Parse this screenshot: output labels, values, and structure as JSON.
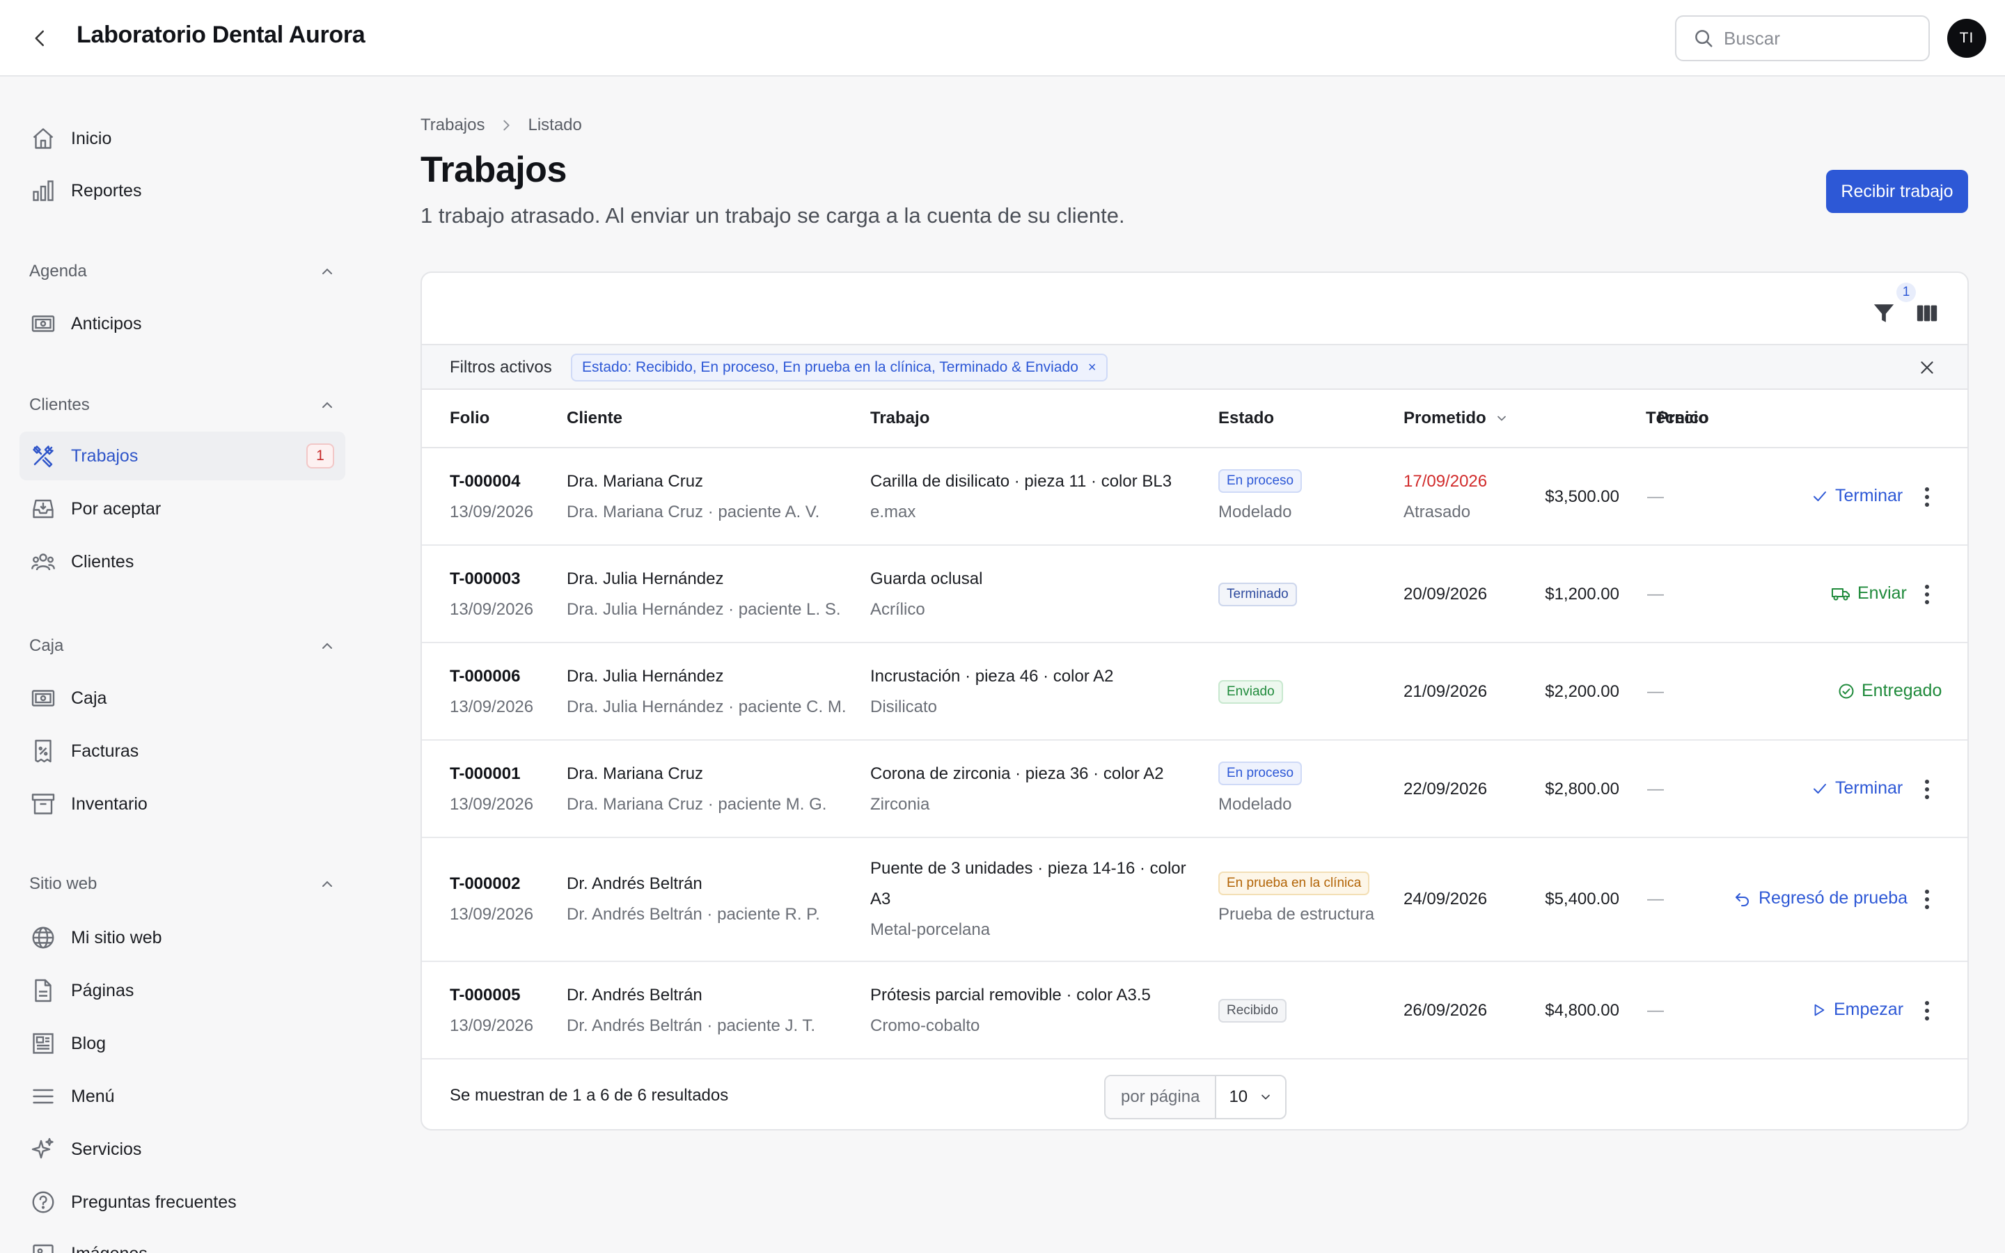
{
  "header": {
    "title": "Laboratorio Dental Aurora",
    "search_placeholder": "Buscar",
    "avatar_initials": "TI"
  },
  "sidebar": {
    "items_top": [
      {
        "label": "Inicio",
        "icon": "home-icon"
      },
      {
        "label": "Reportes",
        "icon": "bar-chart-icon"
      }
    ],
    "sections": [
      {
        "title": "Agenda",
        "items": [
          {
            "label": "Anticipos",
            "icon": "cash-icon"
          }
        ]
      },
      {
        "title": "Clientes",
        "items": [
          {
            "label": "Trabajos",
            "icon": "tools-icon",
            "active": true,
            "badge": "1"
          },
          {
            "label": "Por aceptar",
            "icon": "inbox-icon"
          },
          {
            "label": "Clientes",
            "icon": "users-icon"
          }
        ]
      },
      {
        "title": "Caja",
        "items": [
          {
            "label": "Caja",
            "icon": "cash-icon"
          },
          {
            "label": "Facturas",
            "icon": "receipt-icon"
          },
          {
            "label": "Inventario",
            "icon": "archive-icon"
          }
        ]
      },
      {
        "title": "Sitio web",
        "items": [
          {
            "label": "Mi sitio web",
            "icon": "globe-icon"
          },
          {
            "label": "Páginas",
            "icon": "file-icon"
          },
          {
            "label": "Blog",
            "icon": "newspaper-icon"
          },
          {
            "label": "Menú",
            "icon": "menu-icon"
          },
          {
            "label": "Servicios",
            "icon": "sparkles-icon"
          },
          {
            "label": "Preguntas frecuentes",
            "icon": "question-icon"
          },
          {
            "label": "Imágenes",
            "icon": "image-icon"
          }
        ]
      }
    ]
  },
  "breadcrumb": {
    "root": "Trabajos",
    "current": "Listado"
  },
  "page": {
    "title": "Trabajos",
    "subtitle": "1 trabajo atrasado. Al enviar un trabajo se carga a la cuenta de su cliente.",
    "primary_action": "Recibir trabajo"
  },
  "toolbar": {
    "filter_count": "1"
  },
  "filters": {
    "label": "Filtros activos",
    "chip": "Estado: Recibido, En proceso, En prueba en la clínica, Terminado & Enviado",
    "chip_remove": "×"
  },
  "table": {
    "columns": {
      "folio": "Folio",
      "cliente": "Cliente",
      "trabajo": "Trabajo",
      "estado": "Estado",
      "prometido": "Prometido",
      "precio": "Precio",
      "tecnico": "Técnico"
    },
    "rows": [
      {
        "folio": "T-000004",
        "fecha": "13/09/2026",
        "cliente": "Dra. Mariana Cruz",
        "cliente_sub": "Dra. Mariana Cruz · paciente A. V.",
        "trabajo": "Carilla de disilicato · pieza 11 · color BL3",
        "trabajo_sub": "e.max",
        "estado": "En proceso",
        "estado_tipo": "proceso",
        "estado_sub": "Modelado",
        "prometido": "17/09/2026",
        "prometido_sub": "Atrasado",
        "precio": "$3,500.00",
        "tecnico": "—",
        "accion": "Terminar",
        "accion_icon": "check-icon",
        "accion_color": "blue",
        "menu": true
      },
      {
        "folio": "T-000003",
        "fecha": "13/09/2026",
        "cliente": "Dra. Julia Hernández",
        "cliente_sub": "Dra. Julia Hernández · paciente L. S.",
        "trabajo": "Guarda oclusal",
        "trabajo_sub": "Acrílico",
        "estado": "Terminado",
        "estado_tipo": "terminado",
        "estado_sub": "",
        "prometido": "20/09/2026",
        "prometido_sub": "",
        "precio": "$1,200.00",
        "tecnico": "—",
        "accion": "Enviar",
        "accion_icon": "truck-icon",
        "accion_color": "green",
        "menu": true
      },
      {
        "folio": "T-000006",
        "fecha": "13/09/2026",
        "cliente": "Dra. Julia Hernández",
        "cliente_sub": "Dra. Julia Hernández · paciente C. M.",
        "trabajo": "Incrustación · pieza 46 · color A2",
        "trabajo_sub": "Disilicato",
        "estado": "Enviado",
        "estado_tipo": "enviado",
        "estado_sub": "",
        "prometido": "21/09/2026",
        "prometido_sub": "",
        "precio": "$2,200.00",
        "tecnico": "—",
        "accion": "Entregado",
        "accion_icon": "check-circle-icon",
        "accion_color": "green",
        "menu": false
      },
      {
        "folio": "T-000001",
        "fecha": "13/09/2026",
        "cliente": "Dra. Mariana Cruz",
        "cliente_sub": "Dra. Mariana Cruz · paciente M. G.",
        "trabajo": "Corona de zirconia · pieza 36 · color A2",
        "trabajo_sub": "Zirconia",
        "estado": "En proceso",
        "estado_tipo": "proceso",
        "estado_sub": "Modelado",
        "prometido": "22/09/2026",
        "prometido_sub": "",
        "precio": "$2,800.00",
        "tecnico": "—",
        "accion": "Terminar",
        "accion_icon": "check-icon",
        "accion_color": "blue",
        "menu": true
      },
      {
        "folio": "T-000002",
        "fecha": "13/09/2026",
        "cliente": "Dr. Andrés Beltrán",
        "cliente_sub": "Dr. Andrés Beltrán · paciente R. P.",
        "trabajo": "Puente de 3 unidades · pieza 14-16 · color",
        "trabajo_line2": "A3",
        "trabajo_sub": "Metal-porcelana",
        "estado": "En prueba en la clínica",
        "estado_tipo": "prueba",
        "estado_sub": "Prueba de estructura",
        "prometido": "24/09/2026",
        "prometido_sub": "",
        "precio": "$5,400.00",
        "tecnico": "—",
        "accion": "Regresó de prueba",
        "accion_icon": "undo-icon",
        "accion_color": "blue",
        "menu": true
      },
      {
        "folio": "T-000005",
        "fecha": "13/09/2026",
        "cliente": "Dr. Andrés Beltrán",
        "cliente_sub": "Dr. Andrés Beltrán · paciente J. T.",
        "trabajo": "Prótesis parcial removible · color A3.5",
        "trabajo_sub": "Cromo-cobalto",
        "estado": "Recibido",
        "estado_tipo": "recibido",
        "estado_sub": "",
        "prometido": "26/09/2026",
        "prometido_sub": "",
        "precio": "$4,800.00",
        "tecnico": "—",
        "accion": "Empezar",
        "accion_icon": "play-icon",
        "accion_color": "blue",
        "menu": true
      }
    ]
  },
  "footer": {
    "results": "Se muestran de 1 a 6 de 6 resultados",
    "per_page_label": "por página",
    "per_page_value": "10"
  },
  "colors": {
    "accent": "#2d58d6",
    "overdue": "#d12b2b",
    "success": "#1f8a3b"
  }
}
